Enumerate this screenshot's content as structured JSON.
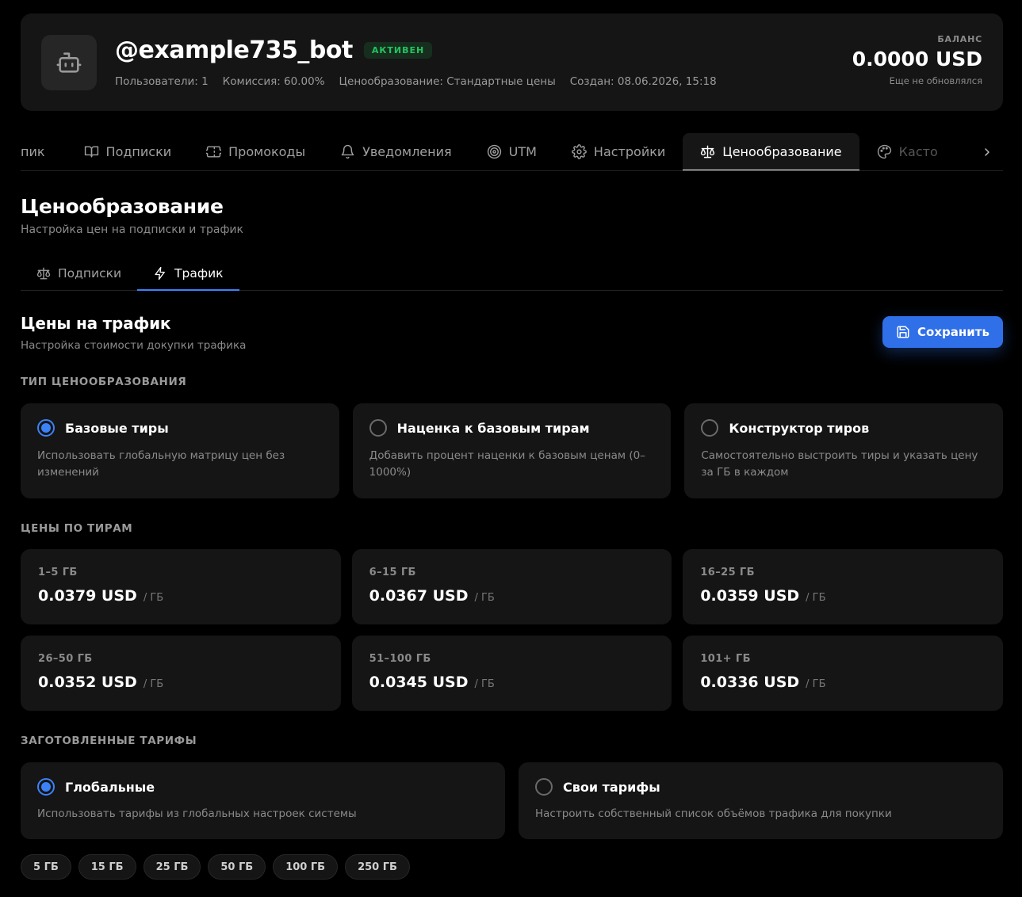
{
  "header": {
    "bot_name": "@example735_bot",
    "status": "АКТИВЕН",
    "meta": {
      "users": "Пользователи: 1",
      "commission": "Комиссия: 60.00%",
      "pricing": "Ценообразование: Стандартные цены",
      "created": "Создан: 08.06.2026, 15:18"
    },
    "balance_label": "БАЛАНС",
    "balance_value": "0.0000 USD",
    "balance_note": "Еще не обновлялся"
  },
  "main_tabs": [
    {
      "label": "пик",
      "icon": "none"
    },
    {
      "label": "Подписки",
      "icon": "book-icon"
    },
    {
      "label": "Промокоды",
      "icon": "ticket-icon"
    },
    {
      "label": "Уведомления",
      "icon": "bell-icon"
    },
    {
      "label": "UTM",
      "icon": "target-icon"
    },
    {
      "label": "Настройки",
      "icon": "gear-icon"
    },
    {
      "label": "Ценообразование",
      "icon": "scales-icon",
      "active": true
    },
    {
      "label": "Касто",
      "icon": "palette-icon"
    }
  ],
  "section": {
    "title": "Ценообразование",
    "subtitle": "Настройка цен на подписки и трафик"
  },
  "sub_tabs": [
    {
      "label": "Подписки",
      "icon": "scales-icon"
    },
    {
      "label": "Трафик",
      "icon": "lightning-icon",
      "active": true
    }
  ],
  "traffic": {
    "title": "Цены на трафик",
    "subtitle": "Настройка стоимости докупки трафика",
    "save_label": "Сохранить",
    "pricing_type_label": "ТИП ЦЕНООБРАЗОВАНИЯ",
    "pricing_types": [
      {
        "title": "Базовые тиры",
        "desc": "Использовать глобальную матрицу цен без изменений",
        "selected": true
      },
      {
        "title": "Наценка к базовым тирам",
        "desc": "Добавить процент наценки к базовым ценам (0–1000%)",
        "selected": false
      },
      {
        "title": "Конструктор тиров",
        "desc": "Самостоятельно выстроить тиры и указать цену за ГБ в каждом",
        "selected": false
      }
    ],
    "tiers_label": "ЦЕНЫ ПО ТИРАМ",
    "unit": "/ ГБ",
    "tiers": [
      {
        "range": "1–5 ГБ",
        "price": "0.0379 USD"
      },
      {
        "range": "6–15 ГБ",
        "price": "0.0367 USD"
      },
      {
        "range": "16–25 ГБ",
        "price": "0.0359 USD"
      },
      {
        "range": "26–50 ГБ",
        "price": "0.0352 USD"
      },
      {
        "range": "51–100 ГБ",
        "price": "0.0345 USD"
      },
      {
        "range": "101+ ГБ",
        "price": "0.0336 USD"
      }
    ],
    "presets_label": "ЗАГОТОВЛЕННЫЕ ТАРИФЫ",
    "presets": [
      {
        "title": "Глобальные",
        "desc": "Использовать тарифы из глобальных настроек системы",
        "selected": true
      },
      {
        "title": "Свои тарифы",
        "desc": "Настроить собственный список объёмов трафика для покупки",
        "selected": false
      }
    ],
    "chips": [
      "5 ГБ",
      "15 ГБ",
      "25 ГБ",
      "50 ГБ",
      "100 ГБ",
      "250 ГБ"
    ]
  },
  "colors": {
    "accent": "#3b82f6",
    "status_green": "#22c55e",
    "card_bg": "#151515"
  }
}
